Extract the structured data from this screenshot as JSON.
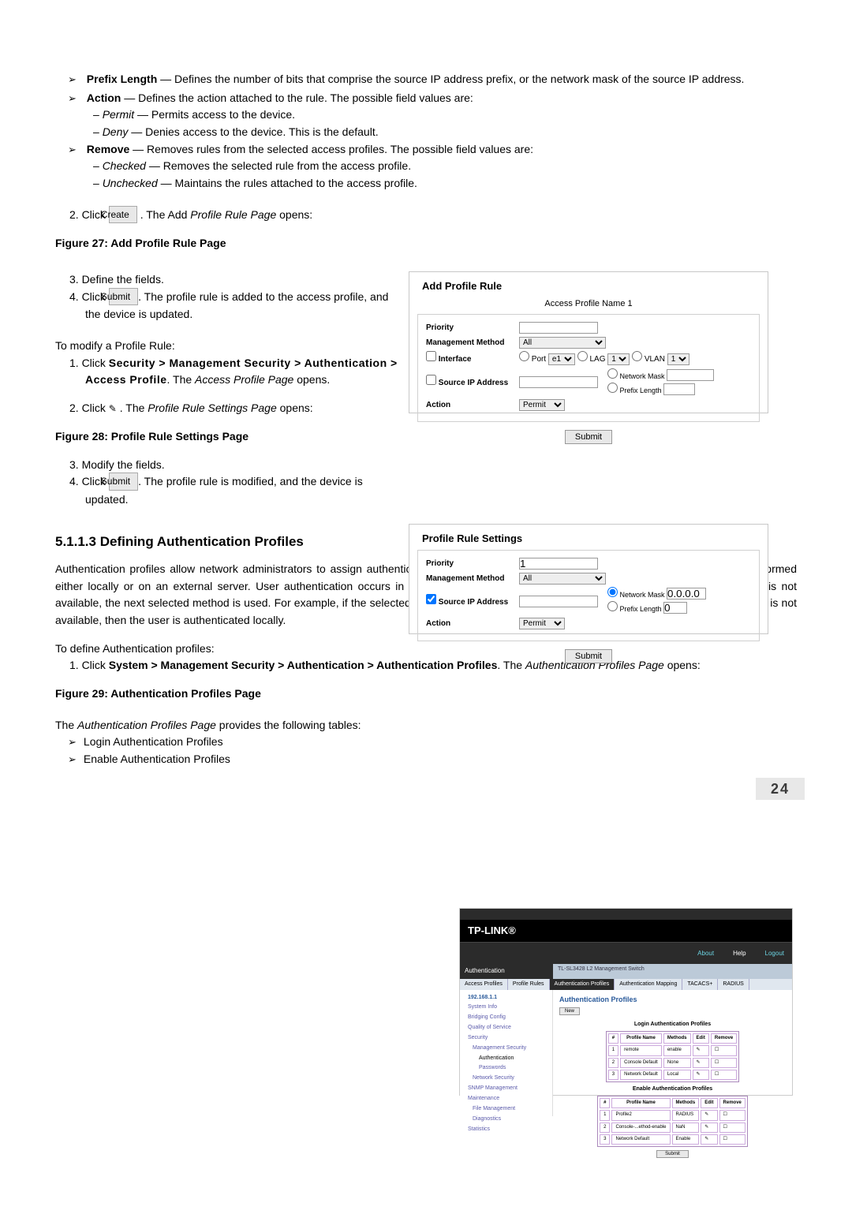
{
  "bullets": {
    "prefix_label": "Prefix Length",
    "prefix_text": " — Defines the number of bits that comprise the source IP address prefix, or the network mask of the source IP address.",
    "action_label": "Action",
    "action_text": " — Defines the action attached to the rule. The possible field values are:",
    "permit_label": "Permit",
    "permit_text": " — Permits access to the device.",
    "deny_label": "Deny",
    "deny_text": " — Denies access to the device. This is the default.",
    "remove_label": "Remove",
    "remove_text": " — Removes rules from the selected access profiles. The possible field values are:",
    "checked_label": "Checked",
    "checked_text": " — Removes the selected rule from the access profile.",
    "unchecked_label": "Unchecked",
    "unchecked_text": " — Maintains the rules attached to the access profile."
  },
  "steps": {
    "s2a": "2.   Click ",
    "create": "Create",
    "s2b": ". The Add ",
    "s2c": "Profile Rule Page",
    "s2d": " opens:",
    "fig27": "Figure 27: Add Profile Rule Page",
    "s3": "3.   Define the fields.",
    "s4a": "4.   Click ",
    "submit": "Submit",
    "s4b": ". The profile rule is added to the access profile, and the device is updated.",
    "modify_intro": "To modify a Profile Rule:",
    "m1a": "1.  Click ",
    "m1b": "Security > Management Security > Authentication > Access Profile",
    "m1c": ". The ",
    "m1d": "Access Profile Page",
    "m1e": " opens.",
    "m2a": "2.   Click ",
    "m2b": " . The ",
    "m2c": "Profile Rule Settings Page",
    "m2d": " opens:",
    "fig28": "Figure 28: Profile Rule Settings Page",
    "m3": "3.   Modify the fields.",
    "m4b": ". The profile rule is modified, and the device is updated."
  },
  "sect": {
    "head": "5.1.1.3   Defining Authentication Profiles",
    "para": "Authentication profiles allow network administrators to assign authentication methods for user authentication. User authentication can be performed either locally or on an external server. User authentication occurs in the order the methods are selected. If the first authentication method is not available, the next selected method is used. For example, if the selected authentication methods are RADIUS and Local, and the RADIUS server is not available, then the user is authenticated locally.",
    "intro2": "To define Authentication profiles:",
    "d1a": "1.   Click ",
    "d1b": "System > Management Security > Authentication > Authentication Profiles",
    "d1c": ". The ",
    "d1d": "Authentication Profiles Page",
    "d1e": " opens:",
    "fig29": "Figure 29: Authentication Profiles Page",
    "para2a": "The ",
    "para2b": "Authentication Profiles Page",
    "para2c": " provides the following tables:",
    "li1": "Login Authentication Profiles",
    "li2": "Enable Authentication Profiles"
  },
  "panelA": {
    "title": "Add Profile Rule",
    "subtitle": "Access Profile Name 1",
    "priority": "Priority",
    "mgmt": "Management Method",
    "mgmt_val": "All",
    "iface": "Interface",
    "port": "Port",
    "port_v": "e1",
    "lag": "LAG",
    "lag_v": "1",
    "vlan": "VLAN",
    "vlan_v": "1",
    "sip": "Source IP Address",
    "nmask": "Network Mask",
    "plen": "Prefix Length",
    "action": "Action",
    "action_v": "Permit",
    "submit": "Submit"
  },
  "panelB": {
    "title": "Profile Rule Settings",
    "priority": "Priority",
    "priority_v": "1",
    "mgmt": "Management Method",
    "mgmt_val": "All",
    "sip": "Source IP Address",
    "nmask": "Network Mask",
    "nmask_v": "0.0.0.0",
    "plen": "Prefix Length",
    "plen_v": "0",
    "action": "Action",
    "action_v": "Permit",
    "submit": "Submit"
  },
  "shot": {
    "brand": "TP-LINK®",
    "authcell": "Authentication",
    "model": "TL-SL3428   L2 Management Switch",
    "about": "About",
    "help": "Help",
    "logout": "Logout",
    "tabs": [
      "Access Profiles",
      "Profile Rules",
      "Authentication Profiles",
      "Authentication Mapping",
      "TACACS+",
      "RADIUS"
    ],
    "side": [
      "192.168.1.1",
      "System Info",
      "Bridging Config",
      "Quality of Service",
      "Security",
      "Management Security",
      "Authentication",
      "Passwords",
      "Network Security",
      "SNMP Management",
      "Maintenance",
      "File Management",
      "Diagnostics",
      "Statistics"
    ],
    "heading": "Authentication Profiles",
    "newbtn": "New",
    "t1": "Login Authentication Profiles",
    "th": [
      "#",
      "Profile Name",
      "Methods",
      "Edit",
      "Remove"
    ],
    "r1": [
      "1",
      "remote",
      "enable",
      "✎",
      "☐"
    ],
    "r2": [
      "2",
      "Console Default",
      "None",
      "✎",
      "☐"
    ],
    "r3": [
      "3",
      "Network Default",
      "Local",
      "✎",
      "☐"
    ],
    "t2": "Enable Authentication Profiles",
    "e1": [
      "1",
      "Profile2",
      "RADIUS",
      "✎",
      "☐"
    ],
    "e2": [
      "2",
      "Console-...ethod-enable",
      "NaN",
      "✎",
      "☐"
    ],
    "e3": [
      "3",
      "Network Default",
      "Enable",
      "✎",
      "☐"
    ],
    "submit": "Submit"
  },
  "page": "24"
}
